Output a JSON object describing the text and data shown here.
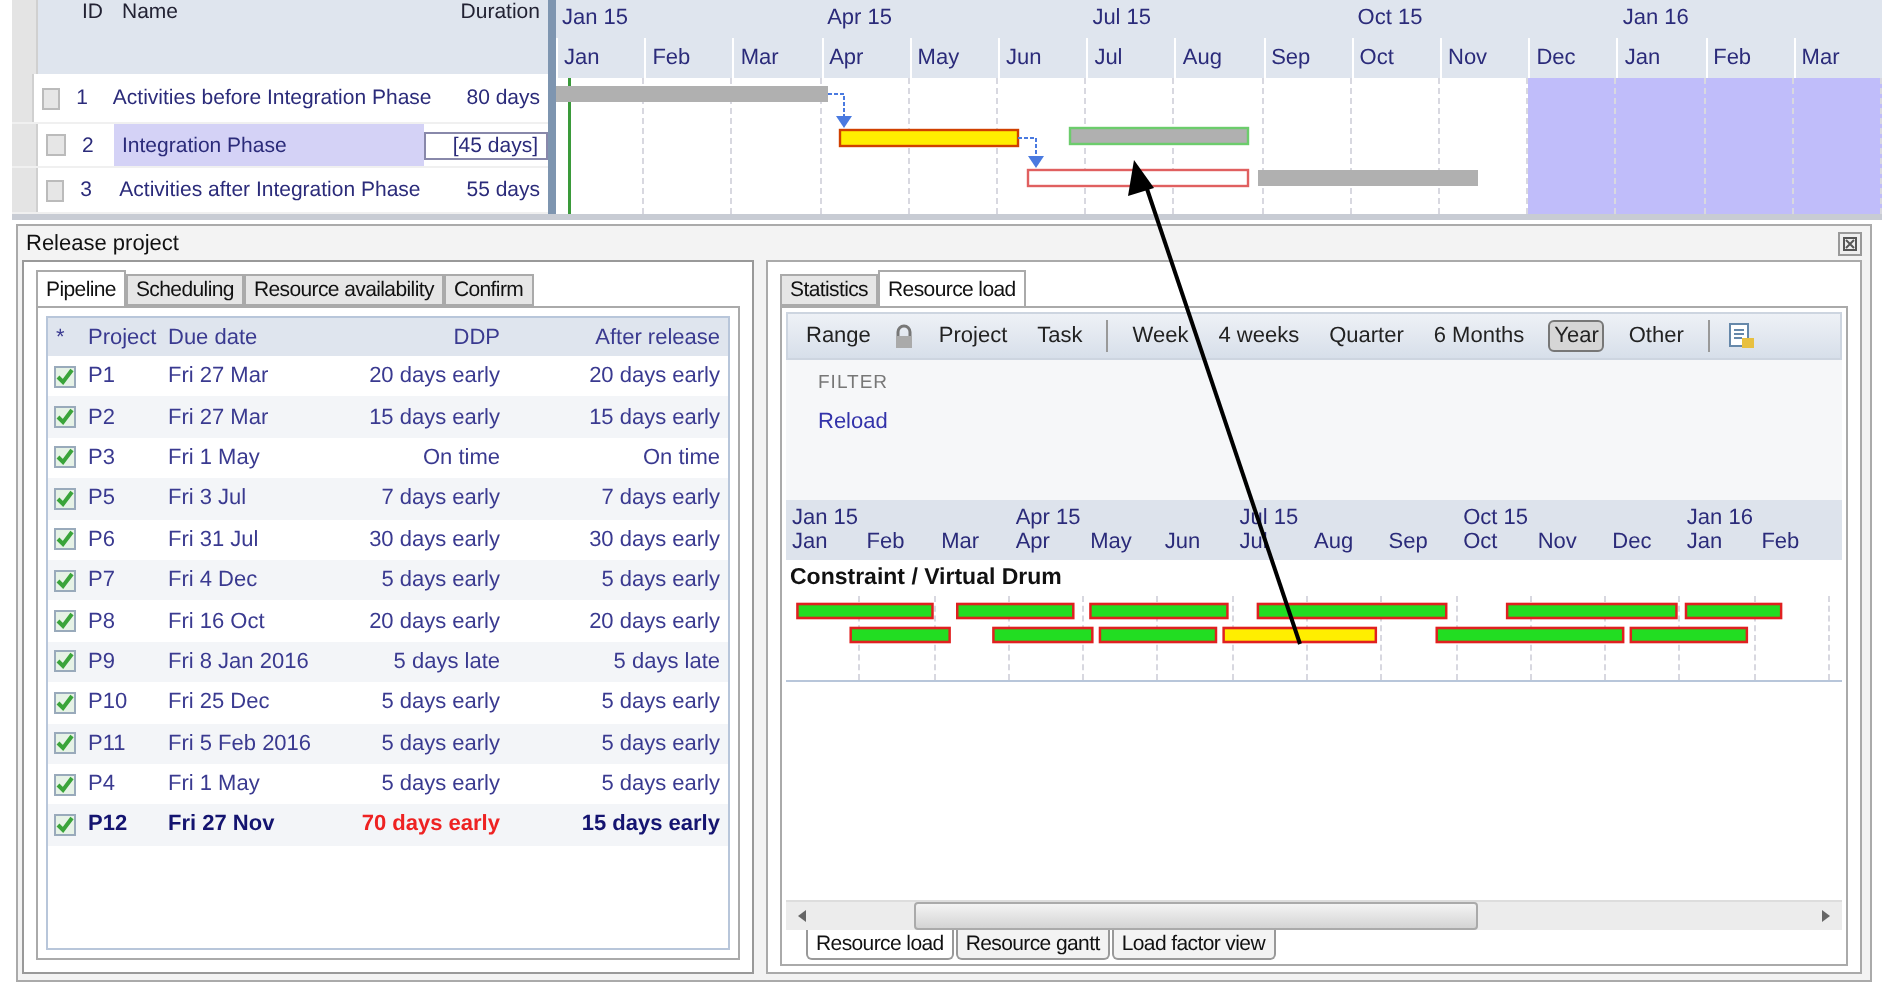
{
  "gantt": {
    "columns": [
      "ID",
      "Name",
      "Duration"
    ],
    "quarters": [
      "Jan 15",
      "Apr 15",
      "Jul 15",
      "Oct 15",
      "Jan 16"
    ],
    "months": [
      {
        "label": "Jan",
        "shaded": false
      },
      {
        "label": "Feb",
        "shaded": false
      },
      {
        "label": "Mar",
        "shaded": false
      },
      {
        "label": "Apr",
        "shaded": false
      },
      {
        "label": "May",
        "shaded": false
      },
      {
        "label": "Jun",
        "shaded": false
      },
      {
        "label": "Jul",
        "shaded": false
      },
      {
        "label": "Aug",
        "shaded": false
      },
      {
        "label": "Sep",
        "shaded": false
      },
      {
        "label": "Oct",
        "shaded": false
      },
      {
        "label": "Nov",
        "shaded": false
      },
      {
        "label": "Dec",
        "shaded": true
      },
      {
        "label": "Jan",
        "shaded": true
      },
      {
        "label": "Feb",
        "shaded": true
      },
      {
        "label": "Mar",
        "shaded": true
      }
    ],
    "tasks": [
      {
        "id": "1",
        "name": "Activities before Integration Phase",
        "duration": "80 days",
        "selected": false
      },
      {
        "id": "2",
        "name": "Integration Phase",
        "duration": "[45 days]",
        "selected": true
      },
      {
        "id": "3",
        "name": "Activities after Integration Phase",
        "duration": "55 days",
        "selected": false
      }
    ]
  },
  "window": {
    "title": "Release project"
  },
  "left_tabs": [
    {
      "label": "Pipeline",
      "selected": true
    },
    {
      "label": "Scheduling",
      "selected": false
    },
    {
      "label": "Resource availability",
      "selected": false
    },
    {
      "label": "Confirm",
      "selected": false
    }
  ],
  "pipeline": {
    "columns": [
      "*",
      "Project",
      "Due date",
      "DDP",
      "After release"
    ],
    "rows": [
      {
        "checked": true,
        "project": "P1",
        "due": "Fri 27 Mar",
        "ddp": "20 days early",
        "after": "20 days early",
        "bold": false,
        "ddp_alert": false
      },
      {
        "checked": true,
        "project": "P2",
        "due": "Fri 27 Mar",
        "ddp": "15 days early",
        "after": "15 days early",
        "bold": false,
        "ddp_alert": false
      },
      {
        "checked": true,
        "project": "P3",
        "due": "Fri 1 May",
        "ddp": "On time",
        "after": "On time",
        "bold": false,
        "ddp_alert": false
      },
      {
        "checked": true,
        "project": "P5",
        "due": "Fri 3 Jul",
        "ddp": "7 days early",
        "after": "7 days early",
        "bold": false,
        "ddp_alert": false
      },
      {
        "checked": true,
        "project": "P6",
        "due": "Fri 31 Jul",
        "ddp": "30 days early",
        "after": "30 days early",
        "bold": false,
        "ddp_alert": false
      },
      {
        "checked": true,
        "project": "P7",
        "due": "Fri 4 Dec",
        "ddp": "5 days early",
        "after": "5 days early",
        "bold": false,
        "ddp_alert": false
      },
      {
        "checked": true,
        "project": "P8",
        "due": "Fri 16 Oct",
        "ddp": "20 days early",
        "after": "20 days early",
        "bold": false,
        "ddp_alert": false
      },
      {
        "checked": true,
        "project": "P9",
        "due": "Fri 8 Jan 2016",
        "ddp": "5 days late",
        "after": "5 days late",
        "bold": false,
        "ddp_alert": false
      },
      {
        "checked": true,
        "project": "P10",
        "due": "Fri 25 Dec",
        "ddp": "5 days early",
        "after": "5 days early",
        "bold": false,
        "ddp_alert": false
      },
      {
        "checked": true,
        "project": "P11",
        "due": "Fri 5 Feb 2016",
        "ddp": "5 days early",
        "after": "5 days early",
        "bold": false,
        "ddp_alert": false
      },
      {
        "checked": true,
        "project": "P4",
        "due": "Fri 1 May",
        "ddp": "5 days early",
        "after": "5 days early",
        "bold": false,
        "ddp_alert": false
      },
      {
        "checked": true,
        "project": "P12",
        "due": "Fri 27 Nov",
        "ddp": "70 days early",
        "after": "15 days early",
        "bold": true,
        "ddp_alert": true
      }
    ]
  },
  "right_tabs": [
    {
      "label": "Statistics",
      "selected": false
    },
    {
      "label": "Resource load",
      "selected": true
    }
  ],
  "toolbar": {
    "range": "Range",
    "scope": [
      "Project",
      "Task"
    ],
    "periods": [
      {
        "label": "Week",
        "selected": false
      },
      {
        "label": "4 weeks",
        "selected": false
      },
      {
        "label": "Quarter",
        "selected": false
      },
      {
        "label": "6 Months",
        "selected": false
      },
      {
        "label": "Year",
        "selected": true
      },
      {
        "label": "Other",
        "selected": false
      }
    ]
  },
  "filter": {
    "label": "FILTER",
    "link": "Reload"
  },
  "resource_chart": {
    "quarters": [
      "Jan 15",
      "Apr 15",
      "Jul 15",
      "Oct 15",
      "Jan 16"
    ],
    "months": [
      "Jan",
      "Feb",
      "Mar",
      "Apr",
      "May",
      "Jun",
      "Jul",
      "Aug",
      "Sep",
      "Oct",
      "Nov",
      "Dec",
      "Jan",
      "Feb"
    ],
    "title": "Constraint / Virtual Drum"
  },
  "bottom_tabs": [
    {
      "label": "Resource load",
      "selected": true
    },
    {
      "label": "Resource gantt",
      "selected": false
    },
    {
      "label": "Load factor view",
      "selected": false
    }
  ]
}
